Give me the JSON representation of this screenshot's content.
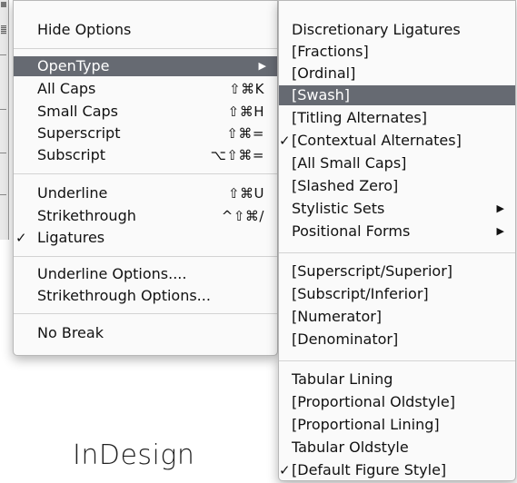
{
  "main_menu": {
    "hide_options": "Hide Options",
    "opentype": "OpenType",
    "all_caps": "All Caps",
    "all_caps_shortcut": "⇧⌘K",
    "small_caps": "Small Caps",
    "small_caps_shortcut": "⇧⌘H",
    "superscript": "Superscript",
    "superscript_shortcut": "⇧⌘=",
    "subscript": "Subscript",
    "subscript_shortcut": "⌥⇧⌘=",
    "underline": "Underline",
    "underline_shortcut": "⇧⌘U",
    "strikethrough": "Strikethrough",
    "strikethrough_shortcut": "^⇧⌘/",
    "ligatures": "Ligatures",
    "underline_options": "Underline Options....",
    "strikethrough_options": "Strikethrough Options...",
    "no_break": "No Break"
  },
  "submenu": {
    "discretionary_ligatures": "Discretionary Ligatures",
    "fractions": "[Fractions]",
    "ordinal": "[Ordinal]",
    "swash": "[Swash]",
    "titling_alternates": "[Titling Alternates]",
    "contextual_alternates": "[Contextual Alternates]",
    "all_small_caps": "[All Small Caps]",
    "slashed_zero": "[Slashed Zero]",
    "stylistic_sets": "Stylistic Sets",
    "positional_forms": "Positional Forms",
    "superscript_superior": "[Superscript/Superior]",
    "subscript_inferior": "[Subscript/Inferior]",
    "numerator": "[Numerator]",
    "denominator": "[Denominator]",
    "tabular_lining": "Tabular Lining",
    "proportional_oldstyle": "[Proportional Oldstyle]",
    "proportional_lining": "[Proportional Lining]",
    "tabular_oldstyle": "Tabular Oldstyle",
    "default_figure_style": "[Default Figure Style]"
  },
  "symbols": {
    "check": "✓",
    "submenu_arrow": "▶"
  },
  "caption": "InDesign",
  "colors": {
    "highlight": "#666a72",
    "menu_bg": "#fafafa"
  }
}
